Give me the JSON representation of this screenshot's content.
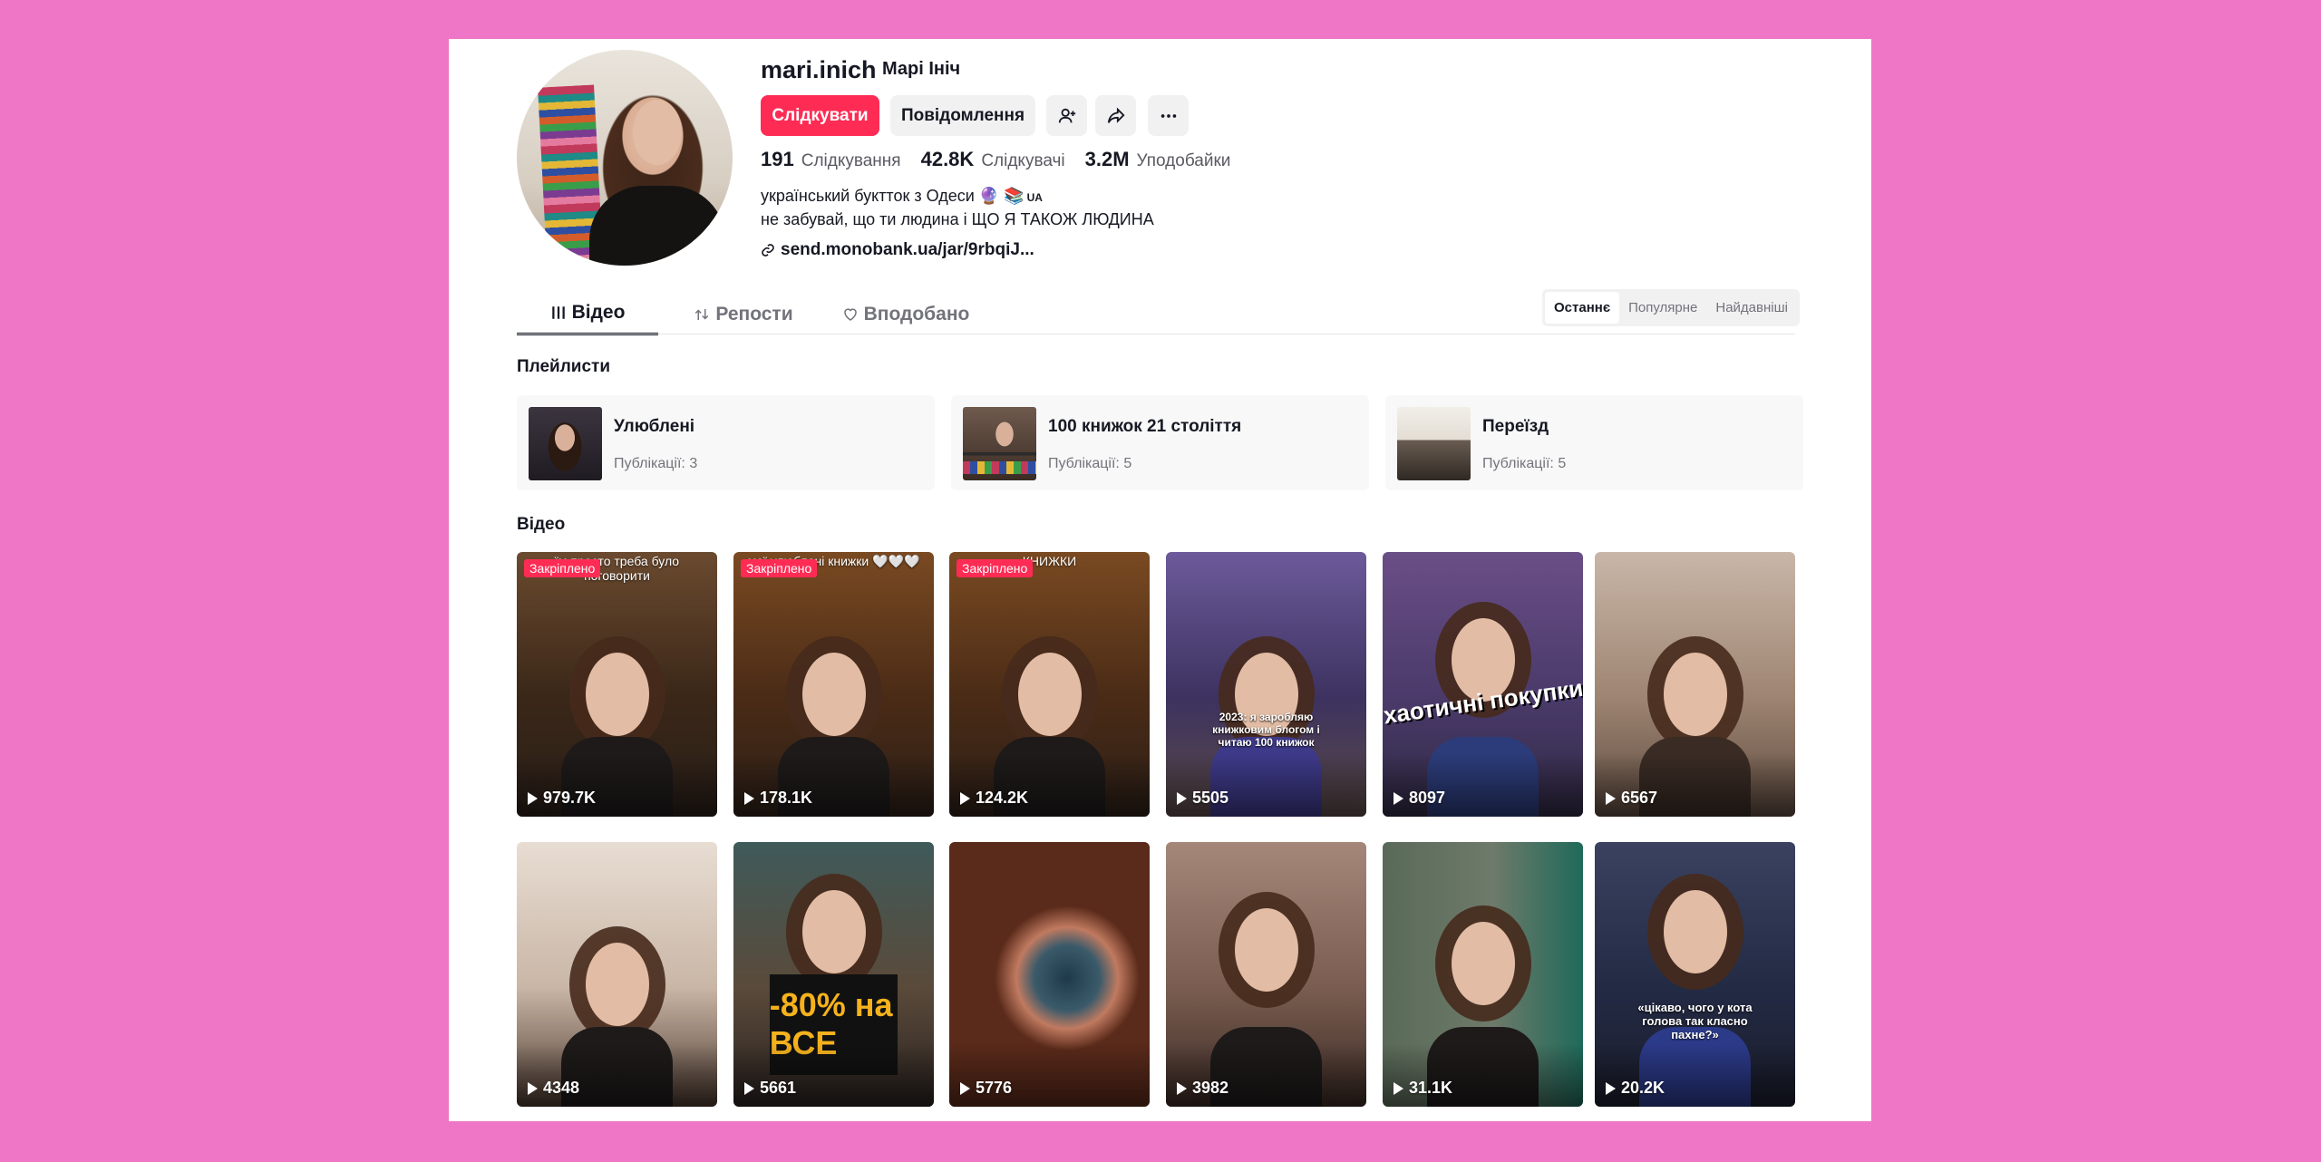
{
  "profile": {
    "username": "mari.inich",
    "nickname": "Марі Ініч",
    "follow_label": "Слідкувати",
    "message_label": "Повідомлення",
    "stats": [
      {
        "value": "191",
        "label": "Слідкування"
      },
      {
        "value": "42.8K",
        "label": "Слідкувачі"
      },
      {
        "value": "3.2M",
        "label": "Уподобайки"
      }
    ],
    "bio_line1": "український буктток з Одеси 🔮 📚",
    "bio_badge": "UA",
    "bio_line2": "не забувай, що ти людина і ЩО Я ТАКОЖ ЛЮДИНА",
    "link": "send.monobank.ua/jar/9rbqiJ..."
  },
  "icons": {
    "add_friend": "add-friend-icon",
    "share": "share-icon",
    "more": "more-icon",
    "link": "link-icon",
    "grid": "grid-icon",
    "repost": "repost-icon",
    "heart": "heart-icon",
    "play": "play-icon"
  },
  "tabs": [
    {
      "label": "Відео",
      "active": true
    },
    {
      "label": "Репости",
      "active": false
    },
    {
      "label": "Вподобано",
      "active": false
    }
  ],
  "sort_options": [
    {
      "label": "Останнє",
      "active": true
    },
    {
      "label": "Популярне",
      "active": false
    },
    {
      "label": "Найдавніші",
      "active": false
    }
  ],
  "playlists_title": "Плейлисти",
  "playlists": [
    {
      "title": "Улюблені",
      "count": "Публікації: 3"
    },
    {
      "title": "100 книжок 21 століття",
      "count": "Публікації: 5"
    },
    {
      "title": "Переїзд",
      "count": "Публікації: 5"
    }
  ],
  "videos_title": "Відео",
  "pinned_label": "Закріплено",
  "videos": [
    {
      "views": "979.7K",
      "pinned": true,
      "caption": "їм просто треба було поговорити"
    },
    {
      "views": "178.1K",
      "pinned": true,
      "caption": "мої улюблені книжки 🤍🤍🤍"
    },
    {
      "views": "124.2K",
      "pinned": true,
      "caption": "КНИЖКИ"
    },
    {
      "views": "5505",
      "pinned": false,
      "caption": "2023: я заробляю книжковим блогом і читаю 100 книжок"
    },
    {
      "views": "8097",
      "pinned": false,
      "caption": "хаотичні покупки"
    },
    {
      "views": "6567",
      "pinned": false,
      "caption": ""
    },
    {
      "views": "4348",
      "pinned": false,
      "caption": ""
    },
    {
      "views": "5661",
      "pinned": false,
      "caption": "-80% на ВСЕ"
    },
    {
      "views": "5776",
      "pinned": false,
      "caption": ""
    },
    {
      "views": "3982",
      "pinned": false,
      "caption": ""
    },
    {
      "views": "31.1K",
      "pinned": false,
      "caption": ""
    },
    {
      "views": "20.2K",
      "pinned": false,
      "caption": "«цікаво, чого у кота голова так класно пахне?»"
    }
  ]
}
